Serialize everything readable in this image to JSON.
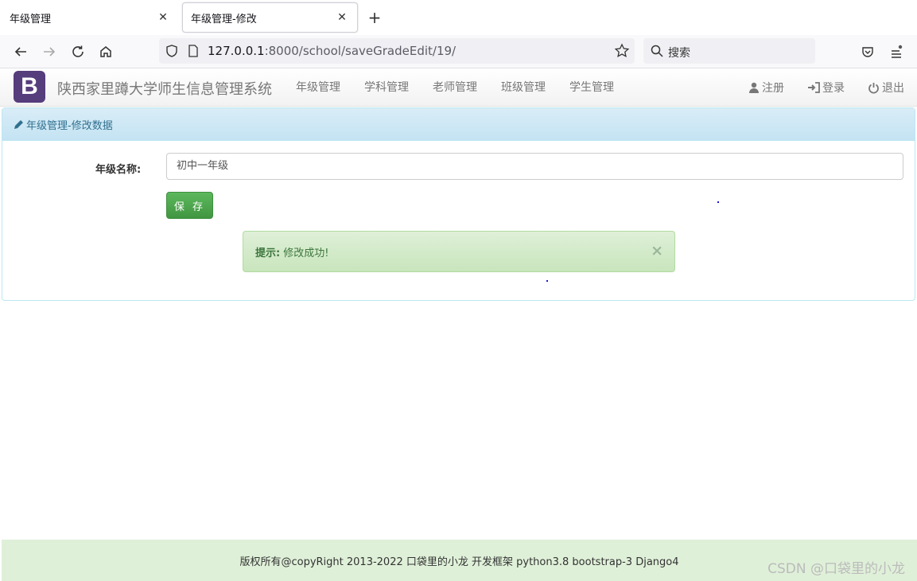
{
  "browser": {
    "tabs": [
      {
        "label": "年级管理"
      },
      {
        "label": "年级管理-修改"
      }
    ],
    "url_host": "127.0.0.1",
    "url_rest": ":8000/school/saveGradeEdit/19/",
    "search_placeholder": "搜索"
  },
  "site": {
    "brand_letter": "B",
    "title": "陕西家里蹲大学师生信息管理系统",
    "nav": [
      "年级管理",
      "学科管理",
      "老师管理",
      "班级管理",
      "学生管理"
    ],
    "register": "注册",
    "login": "登录",
    "logout": "退出"
  },
  "panel": {
    "heading": "年级管理-修改数据",
    "field_label": "年级名称:",
    "field_value": "初中一年级",
    "save_label": "保 存",
    "alert_prefix": "提示:",
    "alert_text": "修改成功!",
    "alert_close": "×"
  },
  "footer": {
    "text": "版权所有@copyRight 2013-2022 口袋里的小龙 开发框架 python3.8 bootstrap-3 Django4"
  },
  "watermark": "CSDN @口袋里的小龙",
  "colors": {
    "brand": "#563d7c",
    "panel_heading": "#d9edf7",
    "save_button": "#5cb85c",
    "alert_bg": "#dff0d8",
    "footer_bg": "#dff0d8"
  }
}
